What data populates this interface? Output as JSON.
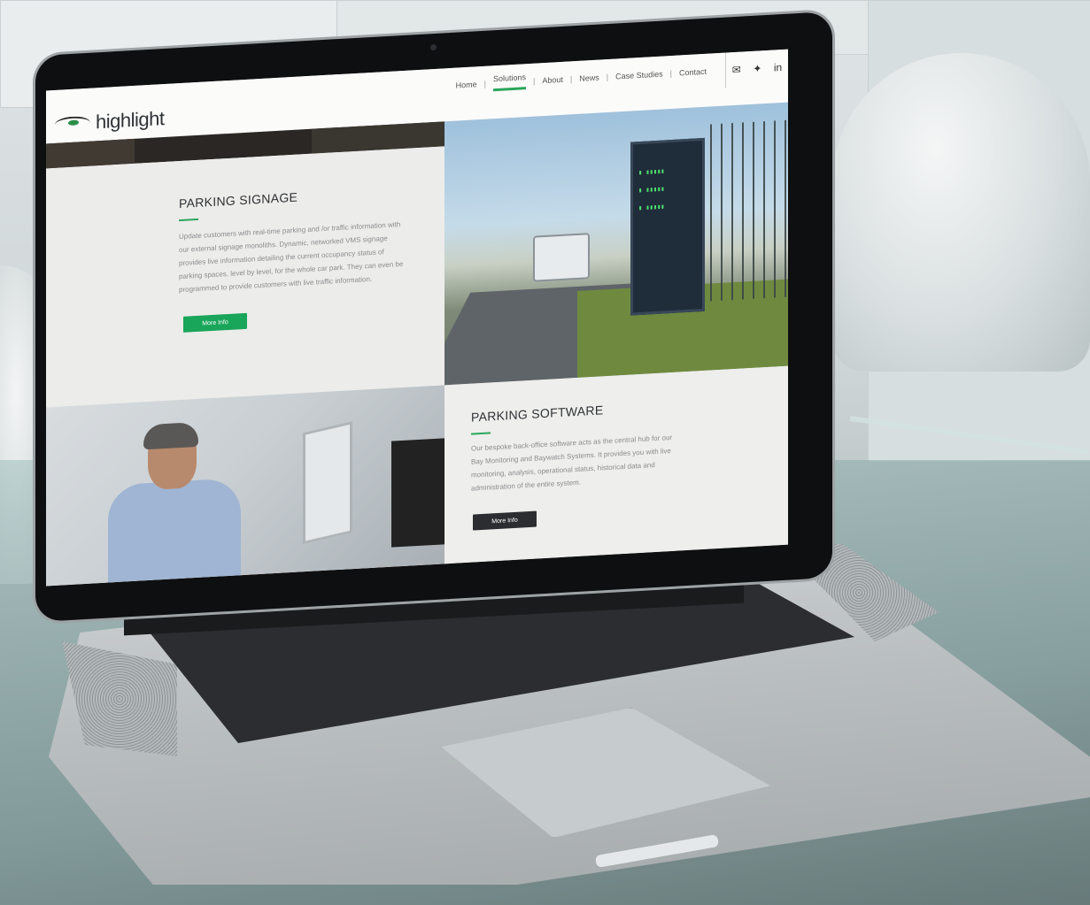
{
  "logo": {
    "text": "highlight"
  },
  "nav": {
    "items": [
      {
        "label": "Home",
        "active": false
      },
      {
        "label": "Solutions",
        "active": true
      },
      {
        "label": "About",
        "active": false
      },
      {
        "label": "News",
        "active": false
      },
      {
        "label": "Case Studies",
        "active": false
      },
      {
        "label": "Contact",
        "active": false
      }
    ],
    "separator": "|",
    "social": [
      "envelope-icon",
      "twitter-icon",
      "linkedin-icon"
    ],
    "linkedin_label": "in"
  },
  "signage": {
    "title": "PARKING SIGNAGE",
    "body": "Update customers with real-time parking and /or traffic information with our external signage monoliths. Dynamic, networked VMS signage provides live information detailing the current occupancy status of parking spaces, level by level, for the whole car park. They can even be programmed to provide customers with live traffic information.",
    "button": "More Info"
  },
  "software": {
    "title": "PARKING SOFTWARE",
    "body": "Our bespoke back-office software acts as the central hub for our Bay Monitoring and Baywatch Systems. It provides you with live monitoring, analysis, operational status, historical data and administration of the entire system.",
    "button": "More Info"
  },
  "colors": {
    "accent": "#19a55a",
    "dark_button": "#2b2d30"
  }
}
